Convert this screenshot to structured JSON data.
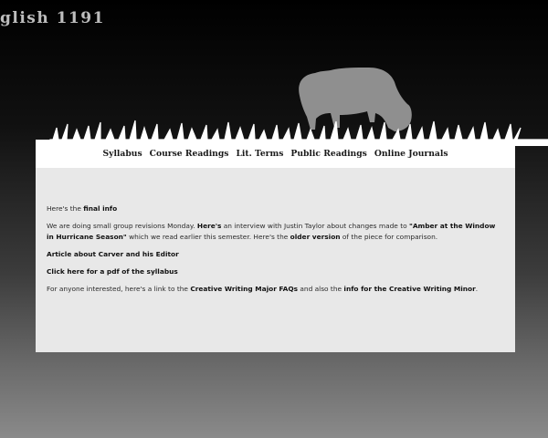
{
  "site": {
    "title": "glish 1191"
  },
  "nav": {
    "items": [
      {
        "label": "Syllabus"
      },
      {
        "label": "Course Readings"
      },
      {
        "label": "Lit. Terms"
      },
      {
        "label": "Public Readings"
      },
      {
        "label": "Online Journals"
      }
    ]
  },
  "content": {
    "p1": {
      "prefix": "Here's the ",
      "link": "final info"
    },
    "p2": {
      "t1": "We are doing small group revisions Monday. ",
      "link1": "Here's",
      "t2": " an interview with Justin Taylor about changes made to ",
      "link2": "\"Amber at the Window in Hurricane Season\"",
      "t3": " which we read earlier this semester. Here's the ",
      "link3": "older version",
      "t4": " of the piece for comparison."
    },
    "p3": {
      "link": "Article about Carver and his Editor"
    },
    "p4": {
      "link": "Click here for a pdf of the syllabus"
    },
    "p5": {
      "t1": "For anyone interested, here's a link to the ",
      "link1": "Creative Writing Major FAQs",
      "t2": " and also the ",
      "link2": "info for the Creative Writing Minor",
      "t3": "."
    }
  },
  "colors": {
    "panel": "#e8e8e8",
    "nav_bg": "#ffffff",
    "title": "#bdbdbd",
    "silhouette": "#8f8f8f",
    "grass": "#ffffff"
  }
}
